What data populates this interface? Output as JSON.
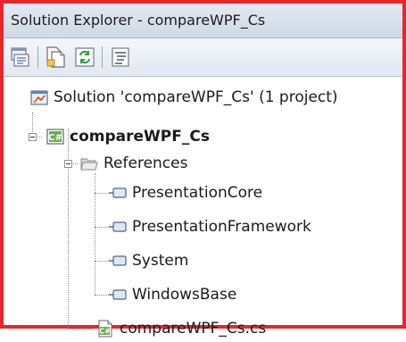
{
  "window": {
    "title": "Solution Explorer - compareWPF_Cs"
  },
  "toolbar": {
    "buttons": [
      {
        "icon": "properties-icon"
      },
      {
        "icon": "show-all-files-icon"
      },
      {
        "icon": "refresh-icon"
      },
      {
        "icon": "view-code-icon"
      }
    ]
  },
  "tree": {
    "solution": {
      "label": "Solution 'compareWPF_Cs' (1 project)",
      "icon": "solution-icon"
    },
    "project": {
      "label": "compareWPF_Cs",
      "icon": "csharp-project-icon",
      "expanded": true
    },
    "references": {
      "label": "References",
      "icon": "folder-open-icon",
      "expanded": true
    },
    "reference_items": [
      {
        "label": "PresentationCore",
        "icon": "reference-icon"
      },
      {
        "label": "PresentationFramework",
        "icon": "reference-icon"
      },
      {
        "label": "System",
        "icon": "reference-icon"
      },
      {
        "label": "WindowsBase",
        "icon": "reference-icon"
      }
    ],
    "file": {
      "label": "compareWPF_Cs.cs",
      "icon": "csharp-file-icon"
    }
  },
  "colors": {
    "frame_border": "#e8262b",
    "title_bar": "#cfd9e6",
    "tree_lines": "#8c8c8c"
  }
}
